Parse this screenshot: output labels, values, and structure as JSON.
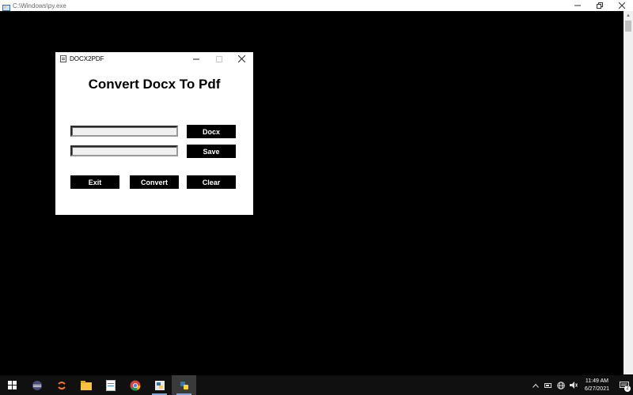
{
  "console": {
    "title": "C:\\Windows\\py.exe",
    "minimize_icon": "minimize-icon",
    "restore_icon": "restore-icon",
    "close_icon": "close-icon"
  },
  "app": {
    "title": "DOCX2PDF",
    "heading": "Convert Docx To Pdf",
    "docx_path": {
      "value": "",
      "placeholder": ""
    },
    "save_path": {
      "value": "",
      "placeholder": ""
    },
    "buttons": {
      "docx": "Docx",
      "save": "Save",
      "exit": "Exit",
      "convert": "Convert",
      "clear": "Clear"
    }
  },
  "taskbar": {
    "items": [
      "start",
      "eclipse",
      "jupyter",
      "file-explorer",
      "notepad",
      "chrome",
      "python-idle",
      "python"
    ],
    "clock": {
      "time": "11:49 AM",
      "date": "6/27/2021"
    },
    "notification_count": "2"
  },
  "colors": {
    "background": "#000000",
    "button_bg": "#000000",
    "button_text": "#ffffff",
    "taskbar": "#101010"
  }
}
